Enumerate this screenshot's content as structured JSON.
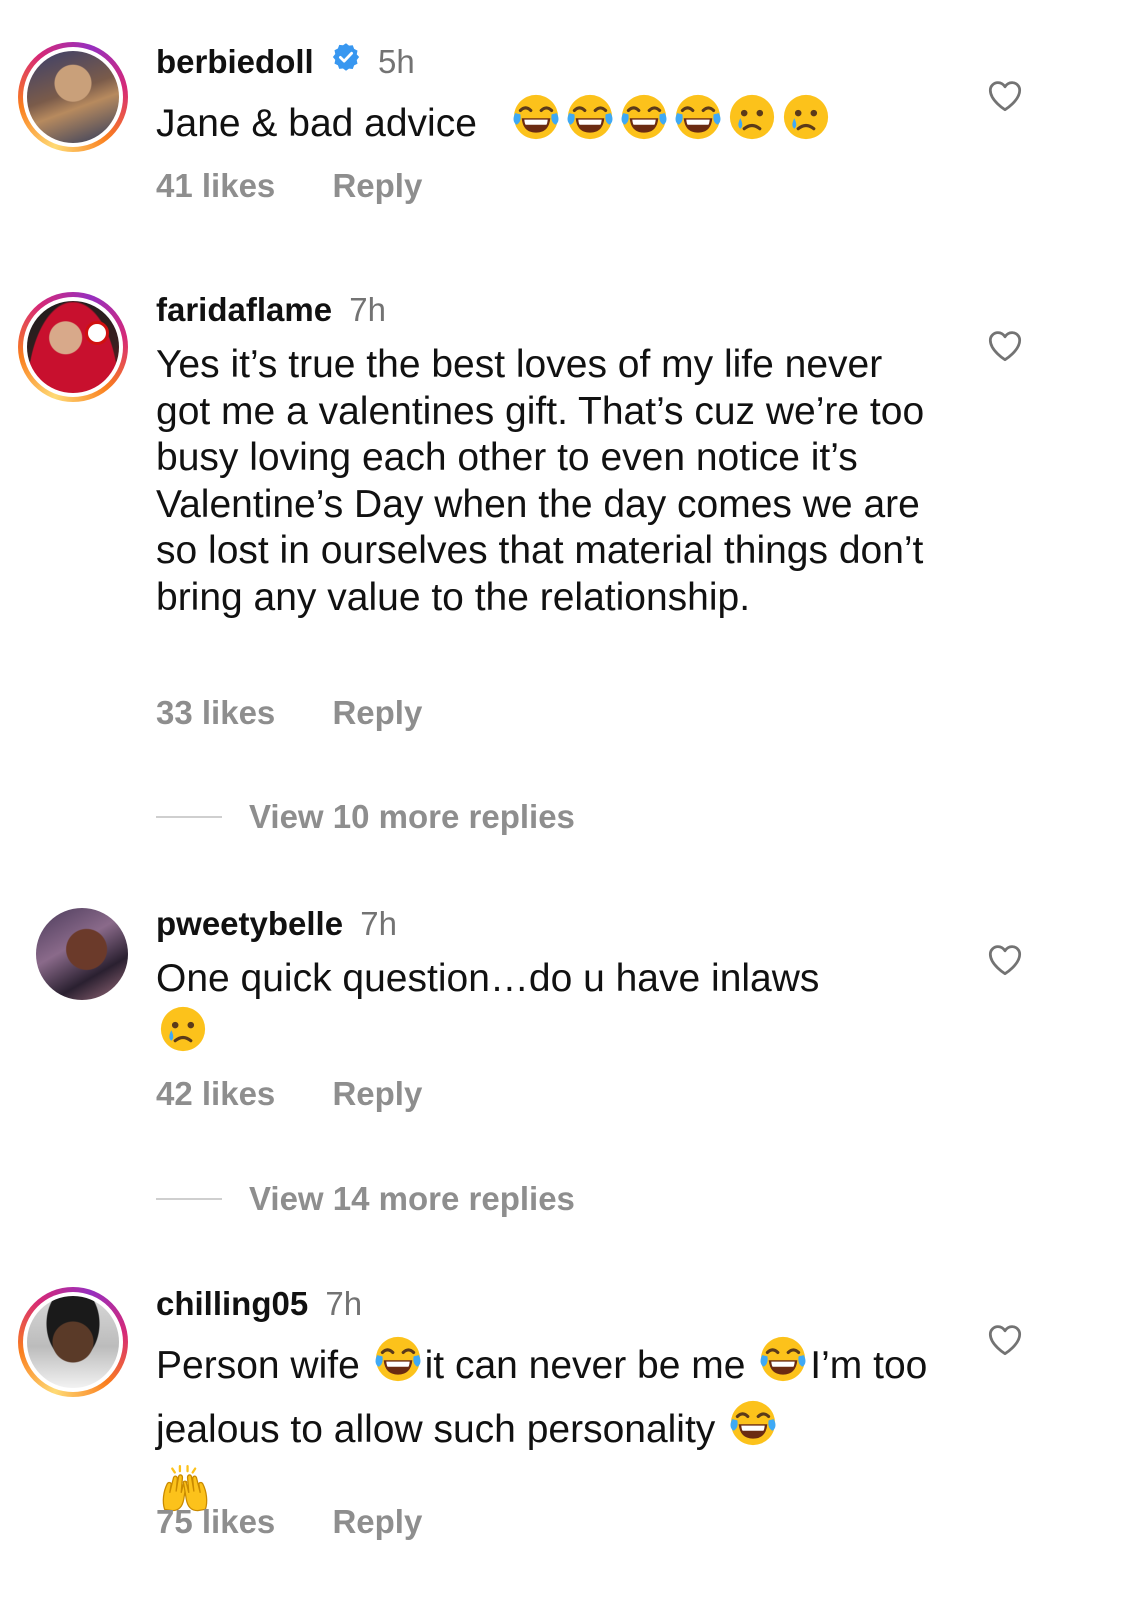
{
  "comments": [
    {
      "username": "berbiedoll",
      "verified": true,
      "time": "5h",
      "text": "Jane & bad advice",
      "likes": "41 likes",
      "reply_label": "Reply",
      "emojis": [
        "joy",
        "joy",
        "joy",
        "joy",
        "cry",
        "cry"
      ]
    },
    {
      "username": "faridaflame",
      "verified": false,
      "time": "7h",
      "text": "Yes it’s true the best loves of my life never got me a valentines gift. That’s cuz we’re too busy loving each other to even notice it’s Valentine’s Day when the day comes we are so lost in ourselves that material things don’t bring any value to the relationship.",
      "likes": "33 likes",
      "reply_label": "Reply",
      "view_more": "View 10 more replies"
    },
    {
      "username": "pweetybelle",
      "verified": false,
      "time": "7h",
      "text": "One quick question…do u have inlaws",
      "likes": "42 likes",
      "reply_label": "Reply",
      "view_more": "View 14 more replies",
      "emojis": [
        "cry"
      ]
    },
    {
      "username": "chilling05",
      "verified": false,
      "time": "7h",
      "text_parts": [
        "Person wife ",
        "it can never be me ",
        "I’m too jealous to allow such personality "
      ],
      "likes": "75 likes",
      "reply_label": "Reply",
      "emojis": [
        "joy",
        "joy",
        "joy",
        "raised-hands"
      ]
    }
  ],
  "colors": {
    "verified_blue": "#3897f0",
    "meta_gray": "#8e8e8e",
    "time_gray": "#737373"
  },
  "icons": {
    "like": "heart-outline-icon",
    "verified": "verified-badge-icon"
  }
}
